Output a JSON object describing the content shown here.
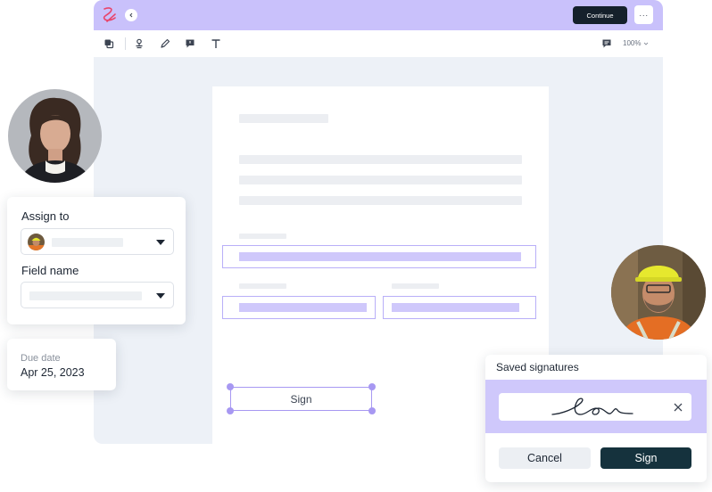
{
  "titlebar": {
    "continue_label": "Continue",
    "more_label": "···"
  },
  "toolbar": {
    "zoom_label": "100%"
  },
  "document": {
    "sign_field_label": "Sign"
  },
  "assign_card": {
    "assign_to_label": "Assign to",
    "field_name_label": "Field name"
  },
  "due_card": {
    "label": "Due date",
    "value": "Apr 25, 2023"
  },
  "signatures": {
    "title": "Saved signatures",
    "cancel_label": "Cancel",
    "sign_label": "Sign"
  },
  "colors": {
    "accent": "#c9c1fb",
    "field": "#cfc8fb",
    "field_outline": "#b9aff8",
    "dark_button": "#15202b",
    "sign_button": "#15323d",
    "logo": "#e8456b"
  },
  "icons": [
    "logo-icon",
    "chevron-left-icon",
    "copy-icon",
    "stamp-icon",
    "pen-icon",
    "comment-icon",
    "text-icon",
    "chat-icon",
    "chevron-down-icon",
    "close-icon"
  ]
}
